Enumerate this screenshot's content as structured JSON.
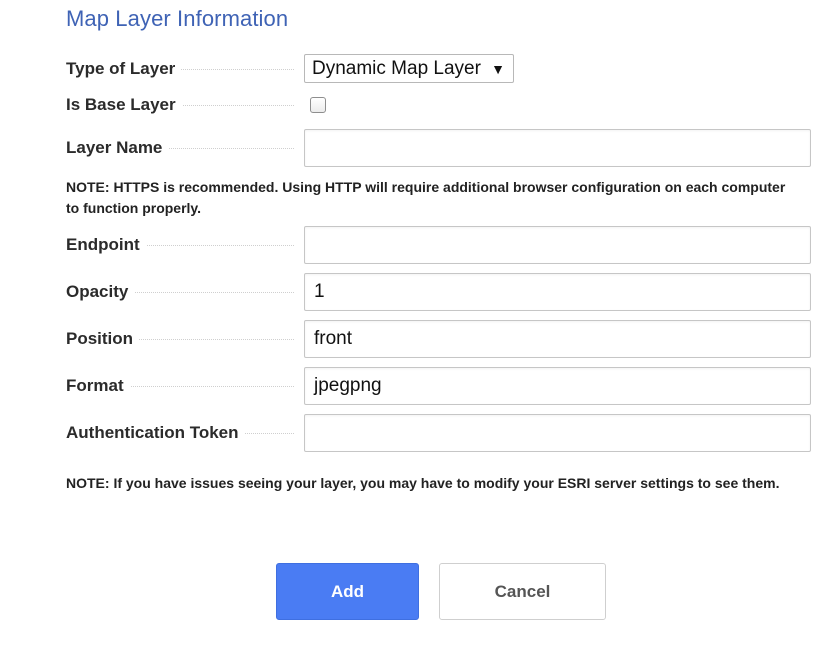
{
  "form": {
    "title": "Map Layer Information",
    "type_of_layer": {
      "label": "Type of Layer",
      "selected": "Dynamic Map Layer",
      "caret": "▼"
    },
    "is_base_layer": {
      "label": "Is Base Layer",
      "checked": false
    },
    "layer_name": {
      "label": "Layer Name",
      "value": ""
    },
    "https_note": "NOTE: HTTPS is recommended. Using HTTP will require additional browser configuration on each computer to function properly.",
    "endpoint": {
      "label": "Endpoint",
      "value": ""
    },
    "opacity": {
      "label": "Opacity",
      "value": "1"
    },
    "position": {
      "label": "Position",
      "value": "front"
    },
    "format": {
      "label": "Format",
      "value": "jpegpng"
    },
    "authentication_token": {
      "label": "Authentication Token",
      "value": ""
    },
    "esri_note": "NOTE: If you have issues seeing your layer, you may have to modify your ESRI server settings to see them."
  },
  "buttons": {
    "add_label": "Add",
    "cancel_label": "Cancel"
  },
  "colors": {
    "title": "#3f63b5",
    "primary_button": "#4a7cf3"
  }
}
